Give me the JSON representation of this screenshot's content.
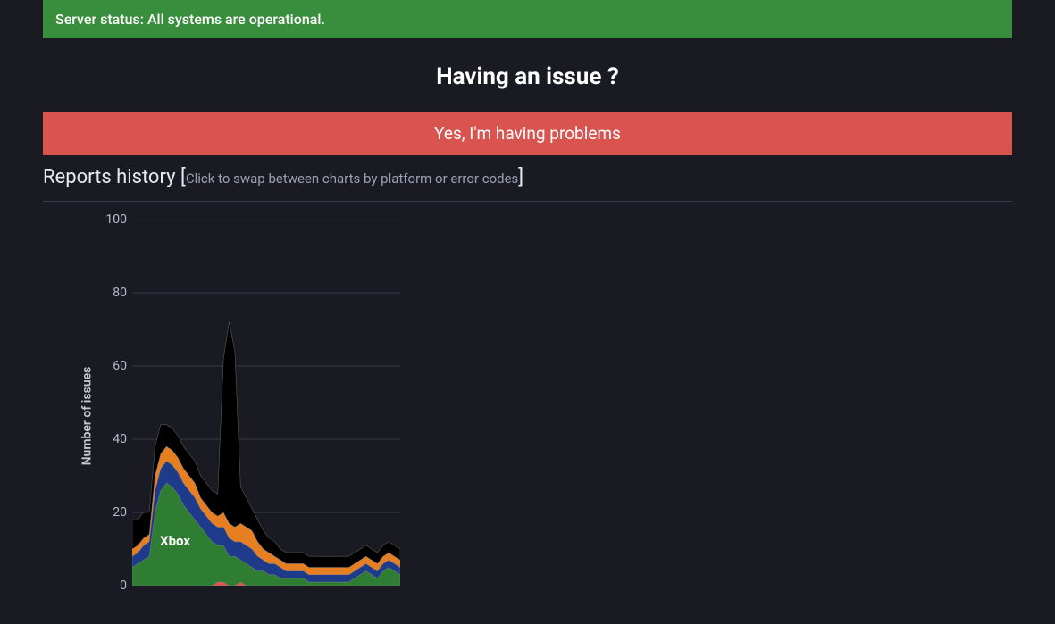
{
  "status": {
    "text": "Server status: All systems are operational."
  },
  "issue": {
    "heading": "Having an issue ?",
    "button": "Yes, I'm having problems"
  },
  "reports": {
    "title": "Reports history",
    "hint": "Click to swap between charts by platform or error codes",
    "bracket_open": "[",
    "bracket_close": "]"
  },
  "chart_data": {
    "type": "area",
    "title": "",
    "xlabel": "",
    "ylabel": "Number of issues",
    "ylim": [
      0,
      100
    ],
    "yticks": [
      0,
      20,
      40,
      60,
      80,
      100
    ],
    "categories_label_shown": "6",
    "series": [
      {
        "name": "Switch",
        "color": "#d9534f",
        "values": [
          0,
          0,
          0,
          0,
          0,
          0,
          0,
          0,
          0,
          0,
          0,
          0,
          0,
          0,
          0,
          1,
          1,
          0,
          0,
          1,
          0,
          0,
          0,
          0,
          0,
          0,
          0,
          0,
          0,
          0,
          0,
          0,
          0,
          0,
          0,
          0,
          0,
          0,
          0,
          0,
          0,
          0,
          0,
          0,
          0,
          0,
          0,
          0
        ]
      },
      {
        "name": "Xbox",
        "color": "#2e7d32",
        "values": [
          5,
          6,
          7,
          8,
          20,
          26,
          28,
          27,
          25,
          22,
          20,
          18,
          16,
          14,
          12,
          10,
          10,
          8,
          8,
          6,
          6,
          5,
          4,
          4,
          3,
          3,
          2,
          2,
          2,
          2,
          2,
          1,
          1,
          1,
          1,
          1,
          1,
          1,
          1,
          2,
          3,
          4,
          3,
          2,
          4,
          5,
          4,
          3
        ]
      },
      {
        "name": "PlayStation",
        "color": "#1e3a8a",
        "values": [
          3,
          3,
          4,
          4,
          6,
          6,
          6,
          6,
          6,
          6,
          6,
          6,
          5,
          5,
          5,
          5,
          5,
          5,
          4,
          5,
          5,
          5,
          4,
          3,
          3,
          3,
          3,
          2,
          2,
          2,
          2,
          2,
          2,
          2,
          2,
          2,
          2,
          2,
          2,
          2,
          2,
          2,
          2,
          2,
          2,
          2,
          2,
          2
        ]
      },
      {
        "name": "PC",
        "color": "#e67e22",
        "values": [
          2,
          2,
          2,
          2,
          4,
          4,
          4,
          4,
          4,
          4,
          4,
          4,
          3,
          3,
          3,
          3,
          4,
          4,
          4,
          5,
          5,
          5,
          4,
          3,
          3,
          2,
          2,
          2,
          2,
          2,
          2,
          2,
          2,
          2,
          2,
          2,
          2,
          2,
          2,
          2,
          2,
          2,
          2,
          2,
          2,
          2,
          2,
          2
        ]
      },
      {
        "name": "Other",
        "color": "#000000",
        "values": [
          8,
          7,
          7,
          6,
          8,
          8,
          6,
          6,
          6,
          6,
          6,
          6,
          6,
          6,
          6,
          6,
          42,
          55,
          48,
          10,
          8,
          6,
          6,
          5,
          4,
          4,
          3,
          3,
          3,
          3,
          3,
          3,
          3,
          3,
          3,
          3,
          3,
          3,
          3,
          3,
          3,
          3,
          3,
          3,
          3,
          3,
          3,
          3
        ]
      }
    ],
    "annotation": {
      "text": "Xbox",
      "series": "Xbox",
      "approx_index": 8
    }
  }
}
